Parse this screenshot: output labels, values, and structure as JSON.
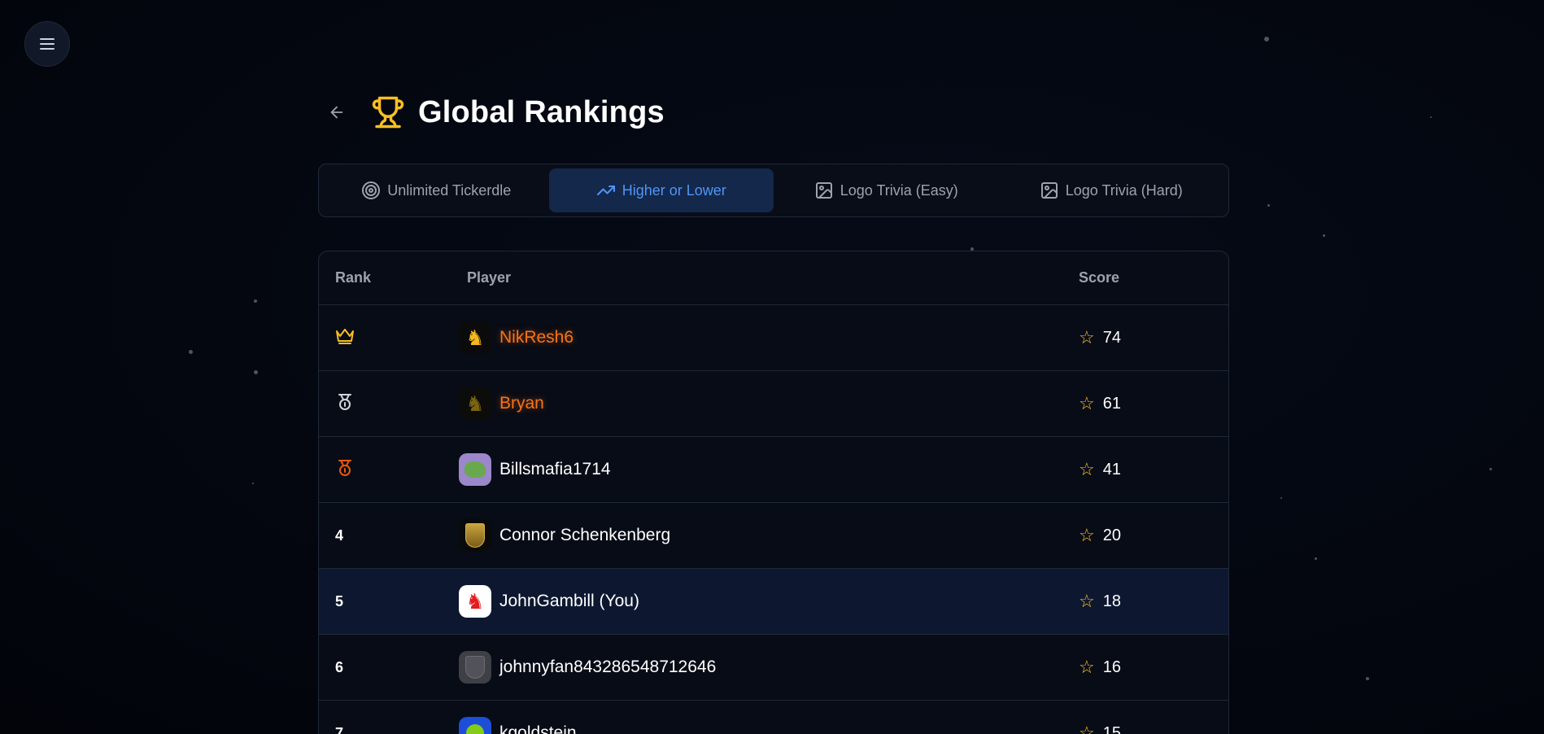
{
  "header": {
    "title": "Global Rankings"
  },
  "tabs": [
    {
      "label": "Unlimited Tickerdle",
      "icon": "target-icon",
      "active": false
    },
    {
      "label": "Higher or Lower",
      "icon": "trending-up-icon",
      "active": true
    },
    {
      "label": "Logo Trivia (Easy)",
      "icon": "image-icon",
      "active": false
    },
    {
      "label": "Logo Trivia (Hard)",
      "icon": "image-icon",
      "active": false
    }
  ],
  "table": {
    "headers": {
      "rank": "Rank",
      "player": "Player",
      "score": "Score"
    },
    "rows": [
      {
        "rank": "",
        "rank_icon": "crown-icon",
        "name": "NikResh6",
        "score": "74",
        "avatar": "ferrari-horse-gold-icon"
      },
      {
        "rank": "",
        "rank_icon": "silver-medal-icon",
        "name": "Bryan",
        "score": "61",
        "avatar": "ferrari-horse-dark-icon"
      },
      {
        "rank": "",
        "rank_icon": "bronze-medal-icon",
        "name": "Billsmafia1714",
        "score": "41",
        "avatar": "green-blob-icon"
      },
      {
        "rank": "4",
        "name": "Connor Schenkenberg",
        "score": "20",
        "avatar": "porsche-crest-icon"
      },
      {
        "rank": "5",
        "name": "JohnGambill (You)",
        "score": "18",
        "avatar": "ferrari-horse-red-icon"
      },
      {
        "rank": "6",
        "name": "johnnyfan843286548712646",
        "score": "16",
        "avatar": "crest-gray-icon"
      },
      {
        "rank": "7",
        "name": "kgoldstein",
        "score": "15",
        "avatar": "globe-blue-icon"
      }
    ]
  },
  "colors": {
    "accent": "#4f95f7",
    "gold": "#fbbf24",
    "orange": "#f97316",
    "silver": "#d1d5db",
    "bronze": "#ea580c"
  }
}
